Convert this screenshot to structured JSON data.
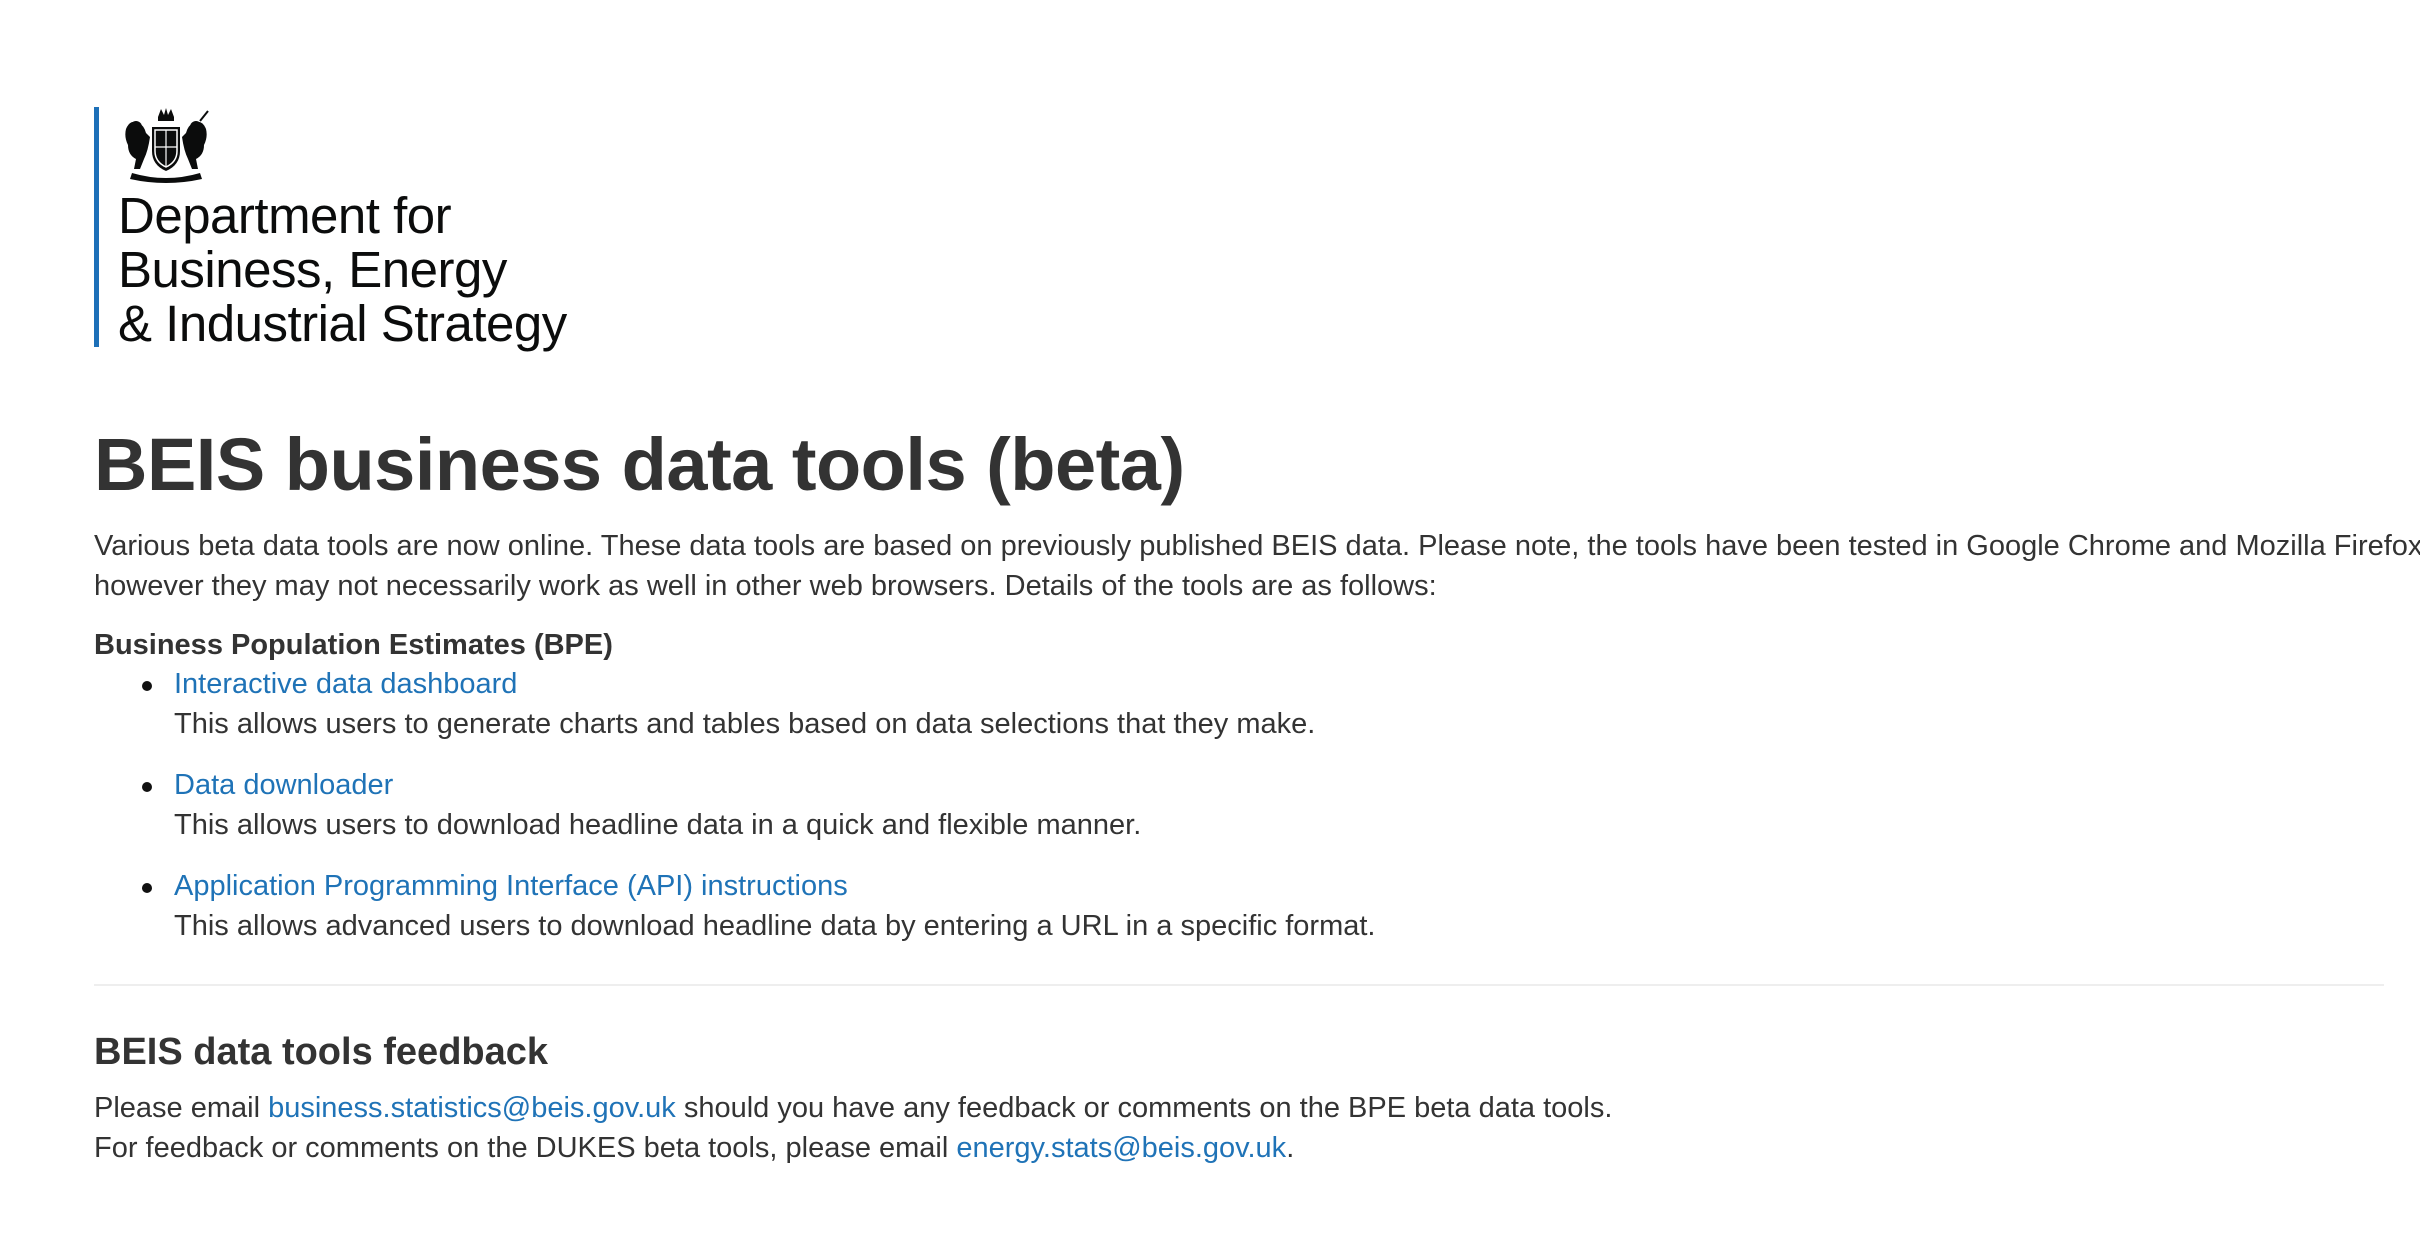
{
  "logo": {
    "line1": "Department for",
    "line2": "Business, Energy",
    "line3": "& Industrial Strategy"
  },
  "title": "BEIS business data tools (beta)",
  "intro": {
    "line1": "Various beta data tools are now online. These data tools are based on previously published BEIS data. Please note, the tools have been tested in Google Chrome and Mozilla Firefox;",
    "line2": "however they may not necessarily work as well in other web browsers. Details of the tools are as follows:"
  },
  "bpe": {
    "heading": "Business Population Estimates (BPE)",
    "tools": [
      {
        "link": "Interactive data dashboard",
        "description": "This allows users to generate charts and tables based on data selections that they make."
      },
      {
        "link": "Data downloader",
        "description": "This allows users to download headline data in a quick and flexible manner."
      },
      {
        "link": "Application Programming Interface (API) instructions",
        "description": "This allows advanced users to download headline data by entering a URL in a specific format."
      }
    ]
  },
  "feedback": {
    "heading": "BEIS data tools feedback",
    "line1_prefix": "Please email ",
    "line1_email": "business.statistics@beis.gov.uk",
    "line1_suffix": " should you have any feedback or comments on the BPE beta data tools.",
    "line2_prefix": "For feedback or comments on the DUKES beta tools, please email ",
    "line2_email": "energy.stats@beis.gov.uk",
    "line2_suffix": "."
  },
  "colors": {
    "link": "#1f73b7",
    "logo_bar": "#1d70b8",
    "text": "#333333"
  }
}
